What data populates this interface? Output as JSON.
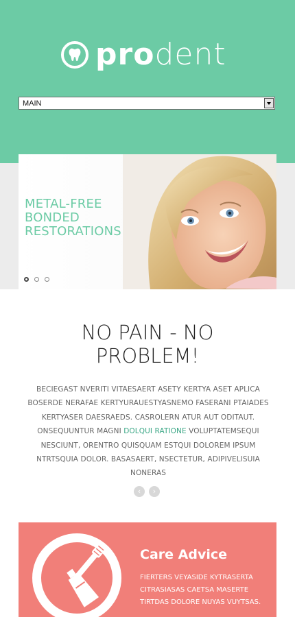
{
  "brand": {
    "pro": "pro",
    "dent": "dent"
  },
  "nav": {
    "selected": "MAIN"
  },
  "slider": {
    "headline": [
      "METAL-FREE",
      "BONDED",
      "RESTORATIONS"
    ],
    "active_dot": 1,
    "dot_count": 3
  },
  "intro": {
    "title_line1": "NO PAIN - NO",
    "title_line2": "PROBLEM!",
    "para_part1": "BECIEGAST NVERITI VITAESAERT ASETY KERTYA ASET APLICA BOSERDE NERAFAE KERTYURAUESTYASNEMO FASERANI PTAIADES KERTYASER DAESRAEDS. CASROLERN ATUR AUT ODITAUT. ONSEQUUNTUR MAGNI ",
    "para_link": "DOLQUI RATIONE",
    "para_part2": " VOLUPTATEMSEQUI NESCIUNT, ORENTRO QUISQUAM ESTQUI DOLOREM IPSUM NTRTSQUIA DOLOR. BASASAERT, NSECTETUR, ADIPIVELISUIA NONERAS"
  },
  "pager": {
    "prev": "‹",
    "next": "›"
  },
  "card": {
    "title": "Care Advice",
    "text": "FIERTERS VEYASIDE KYTRASERTA CITRASIASAS CAETSA MASERTE TIRTDAS DOLORE NUYAS VUYTSAS."
  },
  "colors": {
    "brand": "#6ccba5",
    "card": "#f17f79"
  }
}
